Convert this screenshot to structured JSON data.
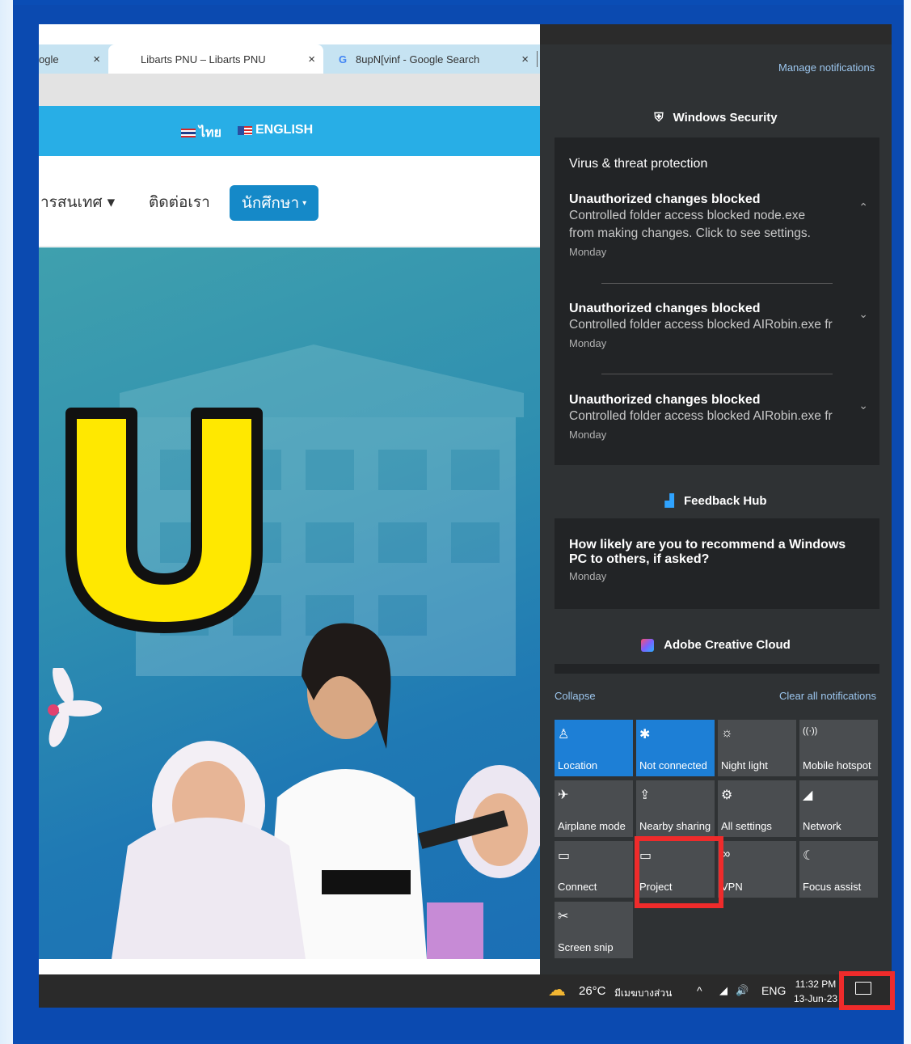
{
  "browser": {
    "tabs": [
      {
        "label": "ogle",
        "close": "×"
      },
      {
        "label": "Libarts PNU – Libarts PNU",
        "close": "×"
      },
      {
        "label": "8upN[vinf - Google Search",
        "close": "×",
        "icon": "G"
      }
    ],
    "lang": {
      "thai": "ไทย",
      "english": "ENGLISH"
    },
    "nav": {
      "item1": "ารสนเทศ ▾",
      "item2": "ติดต่อเรา",
      "button": "นักศึกษา",
      "caret": "▾"
    },
    "hero": {
      "big_letter": "U"
    }
  },
  "action_center": {
    "manage_link": "Manage notifications",
    "groups": [
      {
        "app": "Windows Security",
        "card_title": "Virus & threat protection",
        "notifications": [
          {
            "title": "Unauthorized changes blocked",
            "body1": "Controlled folder access blocked node.exe",
            "body2": "from making changes. Click to see settings.",
            "time": "Monday",
            "chevron": "⌃"
          },
          {
            "title": "Unauthorized changes blocked",
            "body1": "Controlled folder access blocked AIRobin.exe fr",
            "time": "Monday",
            "chevron": "⌄"
          },
          {
            "title": "Unauthorized changes blocked",
            "body1": "Controlled folder access blocked AIRobin.exe fr",
            "time": "Monday",
            "chevron": "⌄"
          }
        ]
      },
      {
        "app": "Feedback Hub",
        "notifications": [
          {
            "title1": "How likely are you to recommend a Windows",
            "title2": "PC to others, if asked?",
            "time": "Monday"
          }
        ]
      },
      {
        "app": "Adobe Creative Cloud"
      }
    ],
    "collapse": "Collapse",
    "clear_all": "Clear all notifications",
    "tiles": [
      {
        "label": "Location",
        "icon": "♙",
        "on": true
      },
      {
        "label": "Not connected",
        "icon": "✱",
        "on": true
      },
      {
        "label": "Night light",
        "icon": "☼",
        "on": false
      },
      {
        "label": "Mobile hotspot",
        "icon": "((·))",
        "on": false
      },
      {
        "label": "Airplane mode",
        "icon": "✈",
        "on": false
      },
      {
        "label": "Nearby sharing",
        "icon": "⇪",
        "on": false
      },
      {
        "label": "All settings",
        "icon": "⚙",
        "on": false
      },
      {
        "label": "Network",
        "icon": "◢",
        "on": false
      },
      {
        "label": "Connect",
        "icon": "▭",
        "on": false
      },
      {
        "label": "Project",
        "icon": "▭",
        "on": false
      },
      {
        "label": "VPN",
        "icon": "∞",
        "on": false
      },
      {
        "label": "Focus assist",
        "icon": "☾",
        "on": false
      },
      {
        "label": "Screen snip",
        "icon": "✂",
        "on": false
      }
    ]
  },
  "taskbar": {
    "temperature": "26°C",
    "weather": "มีเมฆบางส่วน",
    "tray_up": "^",
    "network_icon": "◢",
    "volume_icon": "🔊",
    "language": "ENG",
    "time": "11:32 PM",
    "date": "13-Jun-23"
  },
  "colors": {
    "frame_blue": "#0b4ab0",
    "highlight_red": "#ef2b2b",
    "tile_on": "#1d7fd6",
    "tile_off": "#4a4d50"
  }
}
